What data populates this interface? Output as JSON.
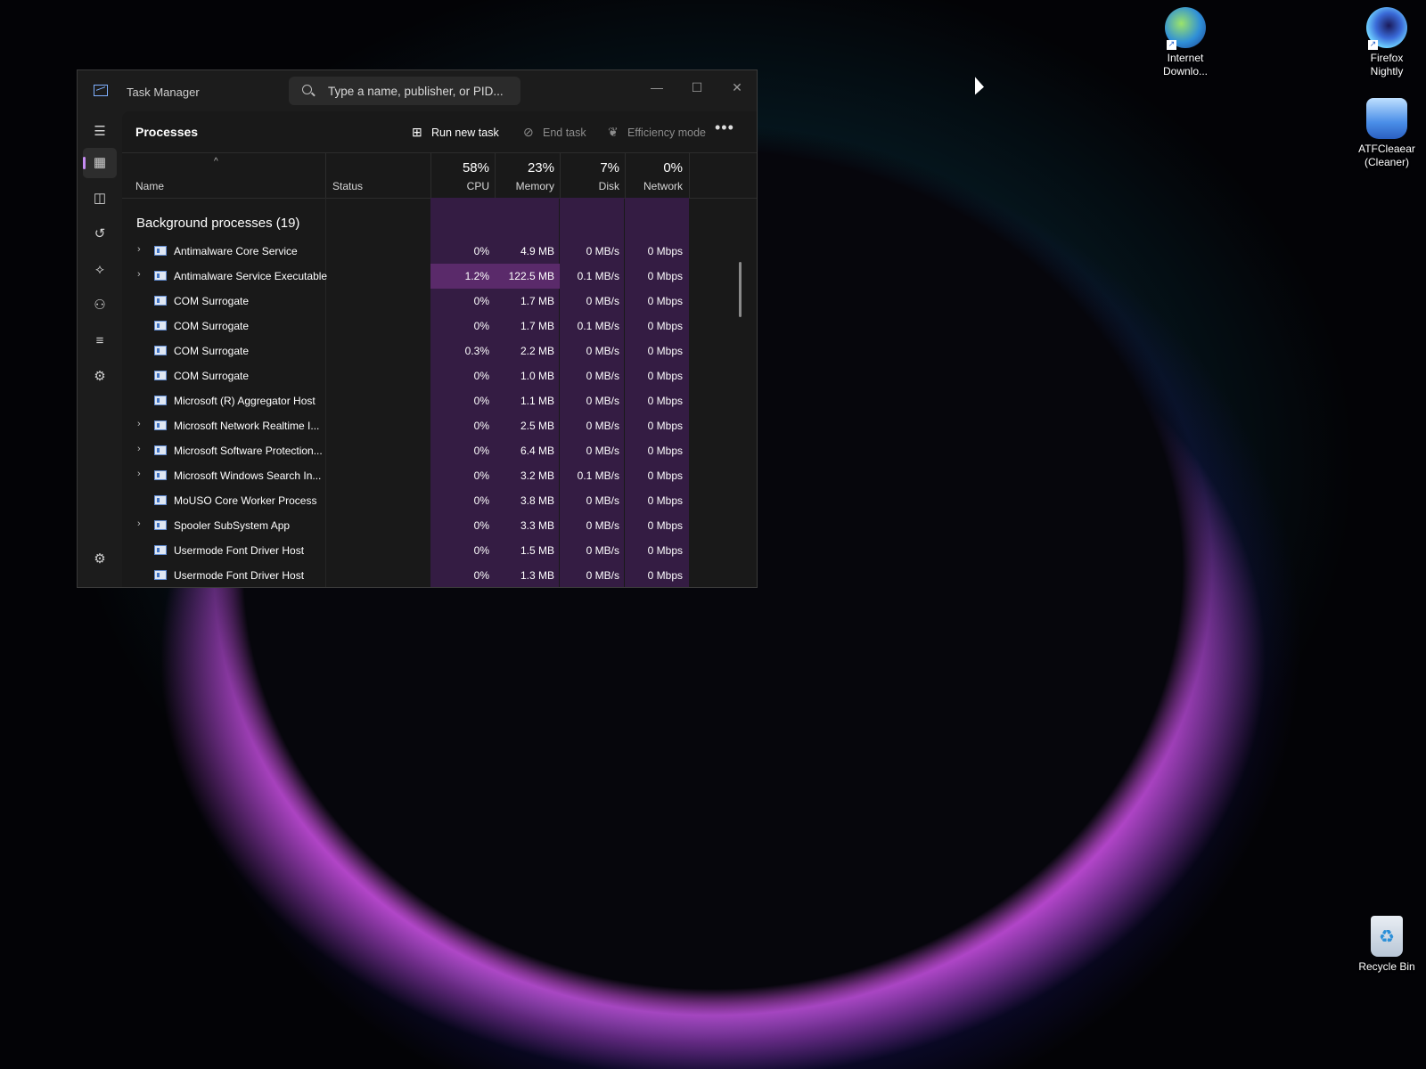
{
  "desktop": {
    "icons": [
      {
        "name": "internet-download-manager",
        "label_line1": "Internet",
        "label_line2": "Downlo...",
        "shortcut": true
      },
      {
        "name": "firefox-nightly",
        "label_line1": "Firefox",
        "label_line2": "Nightly",
        "shortcut": true
      },
      {
        "name": "atfcleaner",
        "label_line1": "ATFCleaear",
        "label_line2": "(Cleaner)",
        "shortcut": false
      },
      {
        "name": "recycle-bin",
        "label_line1": "Recycle Bin",
        "label_line2": "",
        "shortcut": false
      }
    ]
  },
  "window": {
    "title": "Task Manager",
    "search_placeholder": "Type a name, publisher, or PID...",
    "controls": {
      "minimize": "—",
      "maximize": "☐",
      "close": "✕"
    }
  },
  "sidebar": {
    "items": [
      {
        "name": "menu-icon",
        "glyph": "☰"
      },
      {
        "name": "processes-icon",
        "glyph": "▦",
        "active": true
      },
      {
        "name": "performance-icon",
        "glyph": "◫"
      },
      {
        "name": "app-history-icon",
        "glyph": "↺"
      },
      {
        "name": "startup-apps-icon",
        "glyph": "⟡"
      },
      {
        "name": "users-icon",
        "glyph": "⚇"
      },
      {
        "name": "details-icon",
        "glyph": "≡"
      },
      {
        "name": "services-icon",
        "glyph": "⚙"
      }
    ],
    "settings_glyph": "⚙"
  },
  "toolbar": {
    "page_title": "Processes",
    "run_new_task": "Run new task",
    "end_task": "End task",
    "efficiency_mode": "Efficiency mode",
    "more": "•••"
  },
  "columns": {
    "sort_caret": "^",
    "name": "Name",
    "status": "Status",
    "cpu": {
      "pct": "58%",
      "label": "CPU"
    },
    "memory": {
      "pct": "23%",
      "label": "Memory"
    },
    "disk": {
      "pct": "7%",
      "label": "Disk"
    },
    "network": {
      "pct": "0%",
      "label": "Network"
    }
  },
  "group": {
    "title": "Background processes (19)"
  },
  "processes": [
    {
      "name": "Antimalware Core Service",
      "expand": true,
      "cpu": "0%",
      "memory": "4.9 MB",
      "disk": "0 MB/s",
      "network": "0 Mbps",
      "highlight": false
    },
    {
      "name": "Antimalware Service Executable",
      "expand": true,
      "cpu": "1.2%",
      "memory": "122.5 MB",
      "disk": "0.1 MB/s",
      "network": "0 Mbps",
      "highlight": true
    },
    {
      "name": "COM Surrogate",
      "expand": false,
      "cpu": "0%",
      "memory": "1.7 MB",
      "disk": "0 MB/s",
      "network": "0 Mbps",
      "highlight": false
    },
    {
      "name": "COM Surrogate",
      "expand": false,
      "cpu": "0%",
      "memory": "1.7 MB",
      "disk": "0.1 MB/s",
      "network": "0 Mbps",
      "highlight": false
    },
    {
      "name": "COM Surrogate",
      "expand": false,
      "cpu": "0.3%",
      "memory": "2.2 MB",
      "disk": "0 MB/s",
      "network": "0 Mbps",
      "highlight": false
    },
    {
      "name": "COM Surrogate",
      "expand": false,
      "cpu": "0%",
      "memory": "1.0 MB",
      "disk": "0 MB/s",
      "network": "0 Mbps",
      "highlight": false
    },
    {
      "name": "Microsoft (R) Aggregator Host",
      "expand": false,
      "cpu": "0%",
      "memory": "1.1 MB",
      "disk": "0 MB/s",
      "network": "0 Mbps",
      "highlight": false
    },
    {
      "name": "Microsoft Network Realtime I...",
      "expand": true,
      "cpu": "0%",
      "memory": "2.5 MB",
      "disk": "0 MB/s",
      "network": "0 Mbps",
      "highlight": false
    },
    {
      "name": "Microsoft Software Protection...",
      "expand": true,
      "cpu": "0%",
      "memory": "6.4 MB",
      "disk": "0 MB/s",
      "network": "0 Mbps",
      "highlight": false
    },
    {
      "name": "Microsoft Windows Search In...",
      "expand": true,
      "cpu": "0%",
      "memory": "3.2 MB",
      "disk": "0.1 MB/s",
      "network": "0 Mbps",
      "highlight": false
    },
    {
      "name": "MoUSO Core Worker Process",
      "expand": false,
      "cpu": "0%",
      "memory": "3.8 MB",
      "disk": "0 MB/s",
      "network": "0 Mbps",
      "highlight": false
    },
    {
      "name": "Spooler SubSystem App",
      "expand": true,
      "cpu": "0%",
      "memory": "3.3 MB",
      "disk": "0 MB/s",
      "network": "0 Mbps",
      "highlight": false
    },
    {
      "name": "Usermode Font Driver Host",
      "expand": false,
      "cpu": "0%",
      "memory": "1.5 MB",
      "disk": "0 MB/s",
      "network": "0 Mbps",
      "highlight": false
    },
    {
      "name": "Usermode Font Driver Host",
      "expand": false,
      "cpu": "0%",
      "memory": "1.3 MB",
      "disk": "0 MB/s",
      "network": "0 Mbps",
      "highlight": false
    }
  ]
}
